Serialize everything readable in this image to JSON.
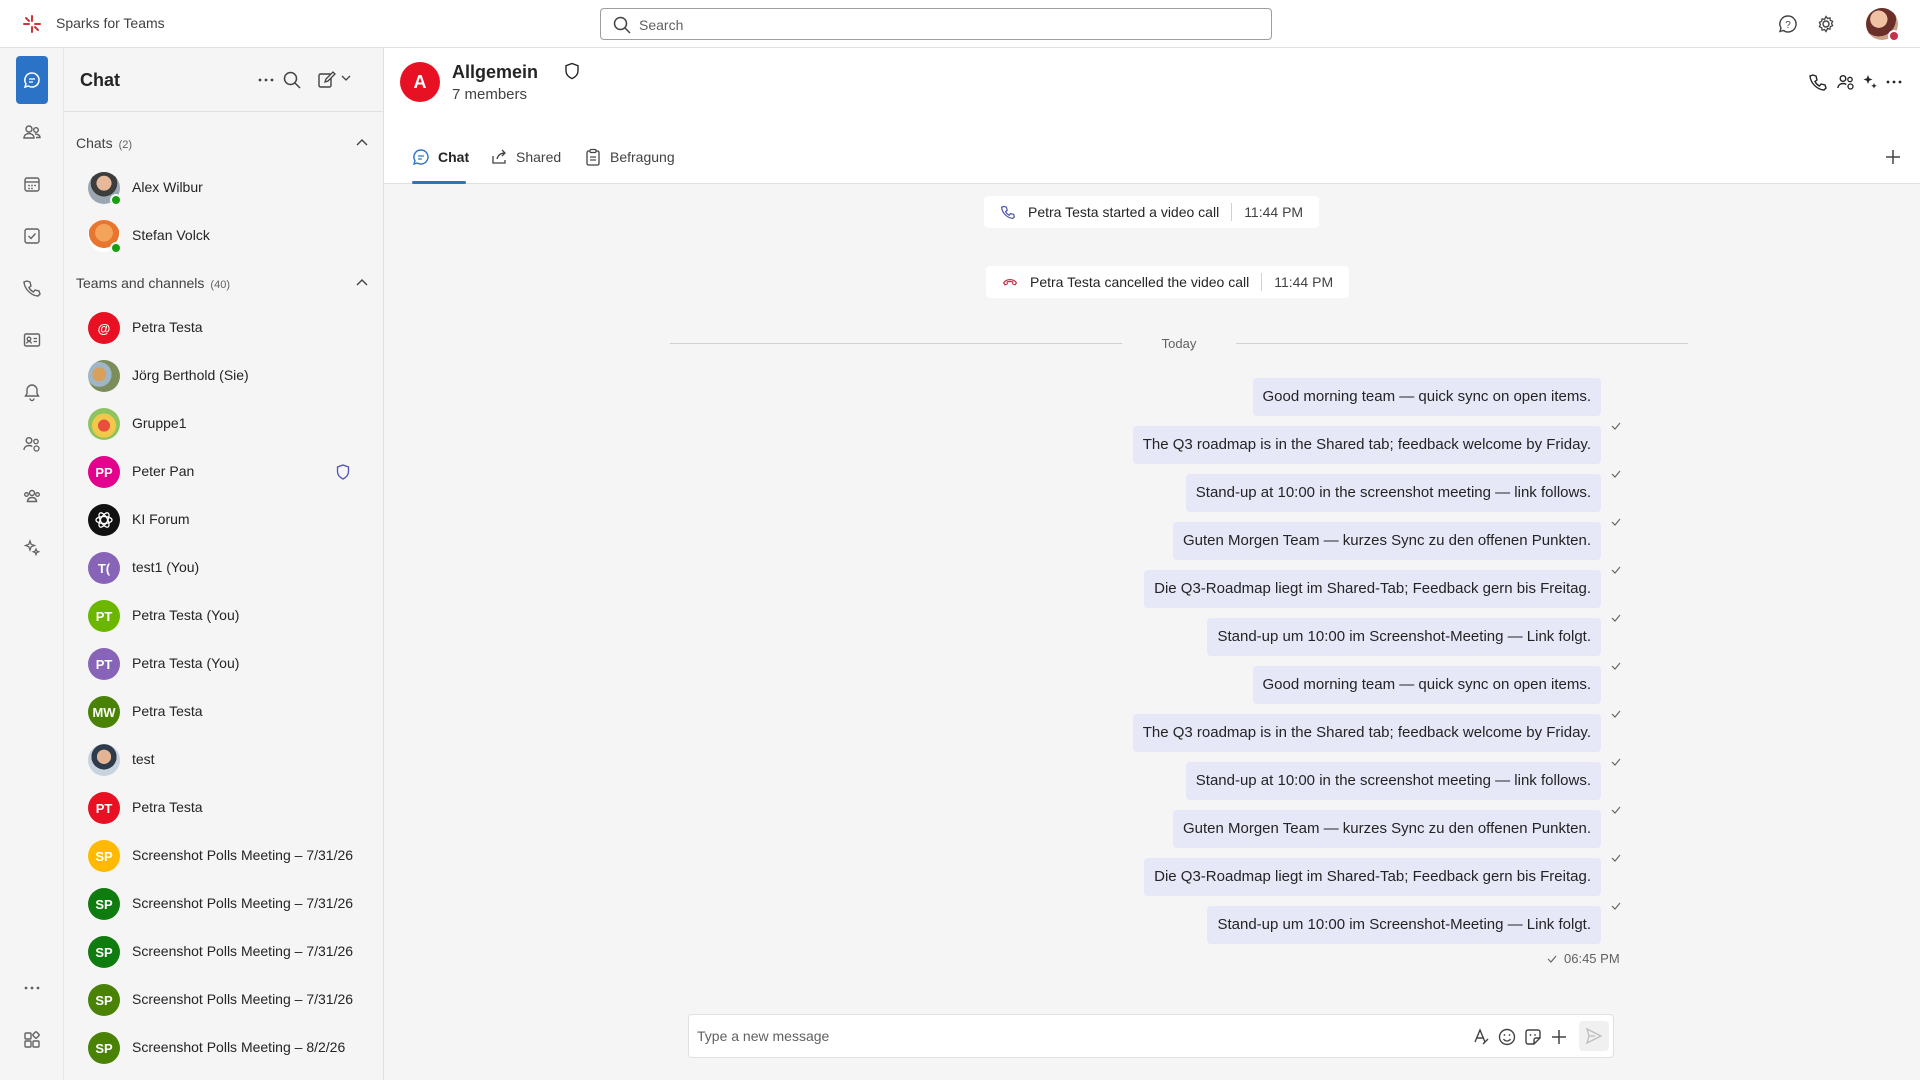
{
  "app": {
    "title": "Sparks for Teams"
  },
  "search": {
    "placeholder": "Search"
  },
  "colors": {
    "accent": "#2b73c7",
    "bubble": "#e6e8f8",
    "presence_available": "#13a10e",
    "presence_busy": "#c4314b"
  },
  "rail": {
    "items": [
      {
        "icon": "chat-icon",
        "active": true
      },
      {
        "icon": "teams-icon"
      },
      {
        "icon": "calendar-icon"
      },
      {
        "icon": "tasks-icon"
      },
      {
        "icon": "calls-icon"
      },
      {
        "icon": "contacts-icon"
      },
      {
        "icon": "bell-icon"
      },
      {
        "icon": "people-settings-icon"
      },
      {
        "icon": "communities-icon"
      },
      {
        "icon": "copilot-icon"
      },
      {
        "icon": "more-icon"
      },
      {
        "icon": "apps-icon"
      }
    ]
  },
  "sidebar": {
    "title": "Chat",
    "chats_section": {
      "label": "Chats",
      "count": "(2)"
    },
    "chats": [
      {
        "name": "Alex Wilbur",
        "avatar": "photo",
        "presence": "available"
      },
      {
        "name": "Stefan Volck",
        "avatar": "photo",
        "presence": "available"
      }
    ],
    "teams_section": {
      "label": "Teams and channels",
      "count": "(40)"
    },
    "teams": [
      {
        "name": "Petra Testa",
        "initials": "@",
        "color": "#e81123"
      },
      {
        "name": "Jörg Berthold (Sie)",
        "avatar": "photo"
      },
      {
        "name": "Gruppe1",
        "avatar": "photo"
      },
      {
        "name": "Peter Pan",
        "initials": "PP",
        "color": "#e3008c",
        "shield": true
      },
      {
        "name": "KI Forum",
        "initials": "",
        "color": "#111111",
        "icon": "openai-icon"
      },
      {
        "name": "test1 (You)",
        "initials": "T(",
        "color": "#8764b8"
      },
      {
        "name": "Petra Testa (You)",
        "initials": "PT",
        "color": "#6bb700"
      },
      {
        "name": "Petra Testa (You)",
        "initials": "PT",
        "color": "#8764b8"
      },
      {
        "name": "Petra Testa",
        "initials": "MW",
        "color": "#498205"
      },
      {
        "name": "test",
        "avatar": "photo"
      },
      {
        "name": "Petra Testa",
        "initials": "PT",
        "color": "#e81123"
      },
      {
        "name": "Screenshot Polls Meeting – 7/31/26",
        "initials": "SP",
        "color": "#ffb900"
      },
      {
        "name": "Screenshot Polls Meeting – 7/31/26",
        "initials": "SP",
        "color": "#107c10"
      },
      {
        "name": "Screenshot Polls Meeting – 7/31/26",
        "initials": "SP",
        "color": "#107c10"
      },
      {
        "name": "Screenshot Polls Meeting – 7/31/26",
        "initials": "SP",
        "color": "#498205"
      },
      {
        "name": "Screenshot Polls Meeting – 8/2/26",
        "initials": "SP",
        "color": "#498205"
      }
    ]
  },
  "channel": {
    "avatar_letter": "A",
    "title": "Allgemein",
    "members": "7 members",
    "tabs": [
      {
        "label": "Chat",
        "icon": "chat-bubble-icon",
        "active": true
      },
      {
        "label": "Shared",
        "icon": "share-icon"
      },
      {
        "label": "Befragung",
        "icon": "clipboard-icon"
      }
    ]
  },
  "system_messages": [
    {
      "text": "Petra Testa started a video call",
      "time": "11:44 PM",
      "icon": "phone-icon"
    },
    {
      "text": "Petra Testa cancelled the video call",
      "time": "11:44 PM",
      "icon": "phone-hangup-icon"
    }
  ],
  "divider": {
    "label": "Today"
  },
  "messages": [
    "Good morning team — quick sync on open items.",
    "The Q3 roadmap is in the Shared tab; feedback welcome by Friday.",
    "Stand-up at 10:00 in the screenshot meeting — link follows.",
    "Guten Morgen Team — kurzes Sync zu den offenen Punkten.",
    "Die Q3-Roadmap liegt im Shared-Tab; Feedback gern bis Freitag.",
    "Stand-up um 10:00 im Screenshot-Meeting — Link folgt.",
    "Good morning team — quick sync on open items.",
    "The Q3 roadmap is in the Shared tab; feedback welcome by Friday.",
    "Stand-up at 10:00 in the screenshot meeting — link follows.",
    "Guten Morgen Team — kurzes Sync zu den offenen Punkten.",
    "Die Q3-Roadmap liegt im Shared-Tab; Feedback gern bis Freitag.",
    "Stand-up um 10:00 im Screenshot-Meeting — Link folgt."
  ],
  "last_time": "06:45 PM",
  "composer": {
    "placeholder": "Type a new message"
  }
}
